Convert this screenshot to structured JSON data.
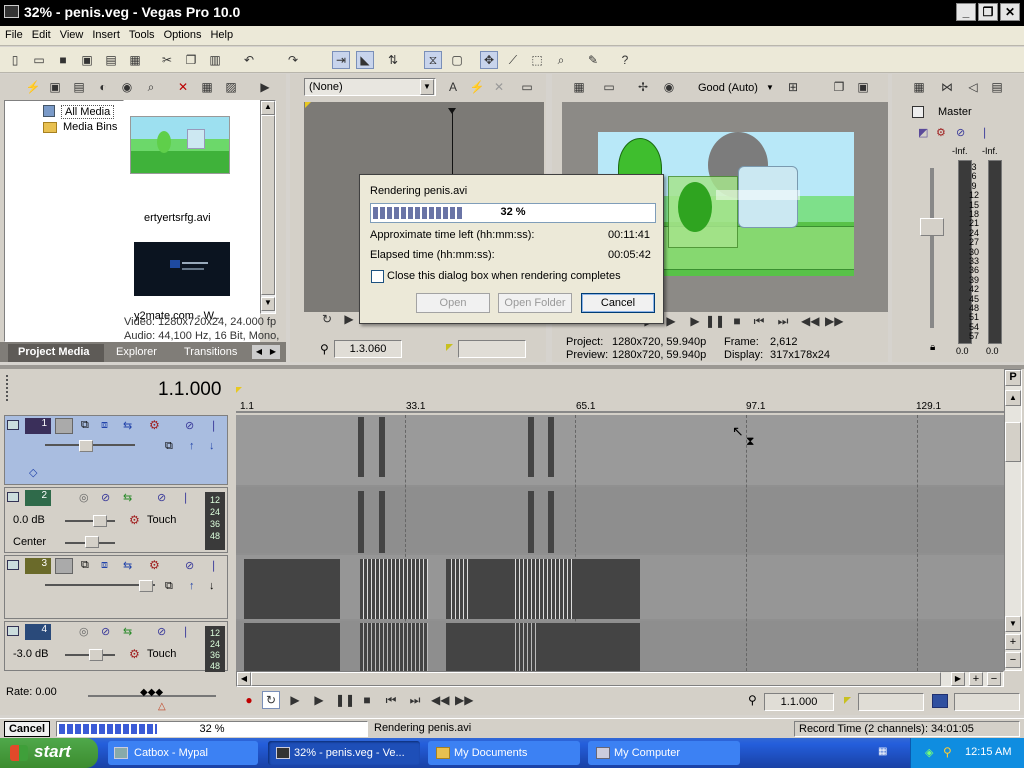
{
  "window": {
    "title": "32% - penis.veg - Vegas Pro 10.0",
    "min": "_",
    "max": "❐",
    "close": "✕"
  },
  "menu": [
    "File",
    "Edit",
    "View",
    "Insert",
    "Tools",
    "Options",
    "Help"
  ],
  "explorer": {
    "tree": [
      "All Media",
      "Media Bins"
    ],
    "media": [
      {
        "name": "ertyertsrfg.avi"
      },
      {
        "name": "y2mate.com - W..."
      }
    ],
    "info_video": "Video: 1280x720x24, 24.000 fp",
    "info_audio": "Audio: 44,100 Hz, 16 Bit, Mono,",
    "tabs": [
      "Project Media",
      "Explorer",
      "Transitions"
    ]
  },
  "trimmer": {
    "preset": "(None)",
    "timecode": "1.3.060"
  },
  "preview": {
    "quality": "Good (Auto)",
    "project_label": "Project:",
    "project_value": "1280x720, 59.940p",
    "preview_label": "Preview:",
    "preview_value": "1280x720, 59.940p",
    "frame_label": "Frame:",
    "frame_value": "2,612",
    "display_label": "Display:",
    "display_value": "317x178x24"
  },
  "mixer": {
    "title": "Master",
    "left": "-Inf.",
    "right": "-Inf.",
    "bottom_left": "0.0",
    "bottom_right": "0.0",
    "scale": [
      "3",
      "6",
      "9",
      "12",
      "15",
      "18",
      "21",
      "24",
      "27",
      "30",
      "33",
      "36",
      "39",
      "42",
      "45",
      "48",
      "51",
      "54",
      "57"
    ]
  },
  "render_dialog": {
    "title": "Rendering penis.avi",
    "percent": "32 %",
    "progress": 0.32,
    "time_left_label": "Approximate time left (hh:mm:ss):",
    "time_left": "00:11:41",
    "elapsed_label": "Elapsed time (hh:mm:ss):",
    "elapsed": "00:05:42",
    "checkbox": "Close this dialog box when rendering completes",
    "open": "Open",
    "open_folder": "Open Folder",
    "cancel": "Cancel"
  },
  "timeline": {
    "cursor": "1.1.000",
    "ruler": [
      "1.1",
      "33.1",
      "65.1",
      "97.1",
      "129.1"
    ],
    "rate": "Rate: 0.00",
    "tracks": [
      {
        "num": "1",
        "color": "#3a2f5a"
      },
      {
        "num": "2",
        "color": "#2f6a4a",
        "db": "0.0 dB",
        "pan": "Center",
        "mode": "Touch",
        "meter": [
          "12",
          "24",
          "36",
          "48"
        ]
      },
      {
        "num": "3",
        "color": "#6a6a2a"
      },
      {
        "num": "4",
        "color": "#2a4a7a",
        "db": "-3.0 dB",
        "mode": "Touch",
        "meter": [
          "12",
          "24",
          "36",
          "48"
        ]
      }
    ],
    "transport_time": "1.1.000"
  },
  "statusbar": {
    "cancel": "Cancel",
    "percent": "32 %",
    "progress": 0.32,
    "message": "Rendering penis.avi",
    "record_time": "Record Time (2 channels): 34:01:05"
  },
  "taskbar": {
    "start": "start",
    "items": [
      "Catbox - Mypal",
      "32% - penis.veg - Ve...",
      "My Documents",
      "My Computer"
    ],
    "clock": "12:15 AM"
  }
}
